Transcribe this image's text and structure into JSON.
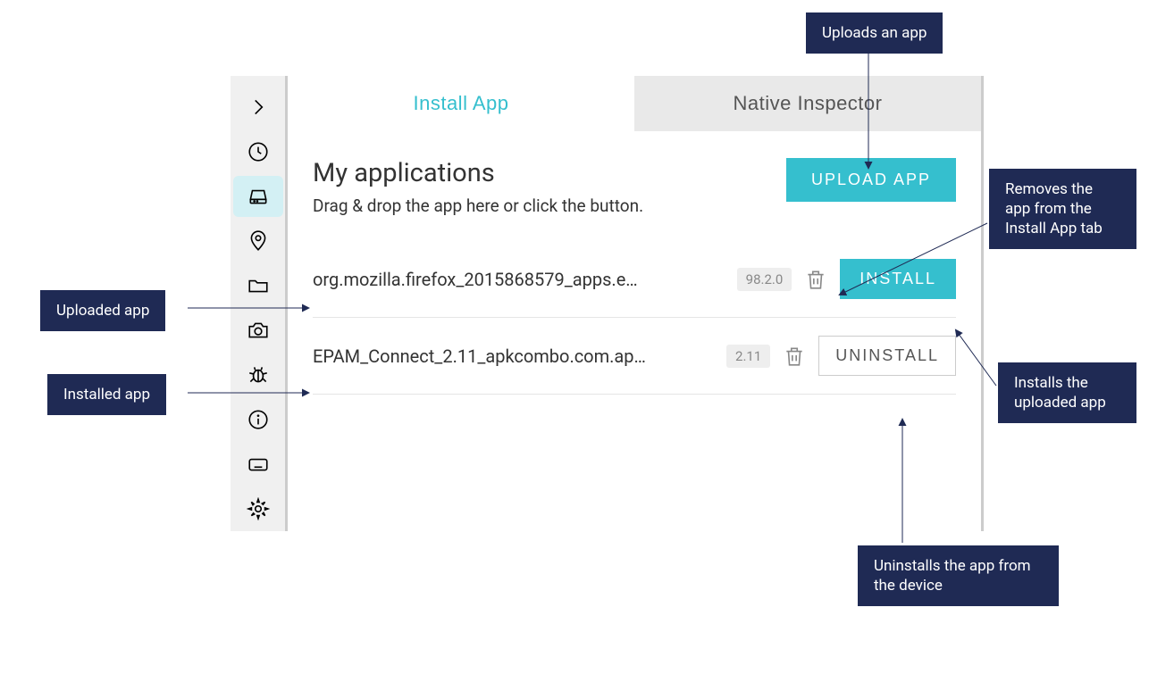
{
  "tabs": {
    "install": "Install App",
    "native": "Native Inspector"
  },
  "header": {
    "title": "My applications",
    "subtitle": "Drag & drop the app here or click the button.",
    "upload_btn": "UPLOAD APP"
  },
  "apps": [
    {
      "name": "org.mozilla.firefox_2015868579_apps.e…",
      "version": "98.2.0",
      "action": "INSTALL",
      "style": "install"
    },
    {
      "name": "EPAM_Connect_2.11_apkcombo.com.ap…",
      "version": "2.11",
      "action": "UNINSTALL",
      "style": "uninstall"
    }
  ],
  "callouts": {
    "upload": "Uploads an app",
    "remove": "Removes the app from the Install App tab",
    "uploaded_app": "Uploaded app",
    "installed_app": "Installed app",
    "installs": "Installs the uploaded app",
    "uninstalls": "Uninstalls the app from the device"
  }
}
